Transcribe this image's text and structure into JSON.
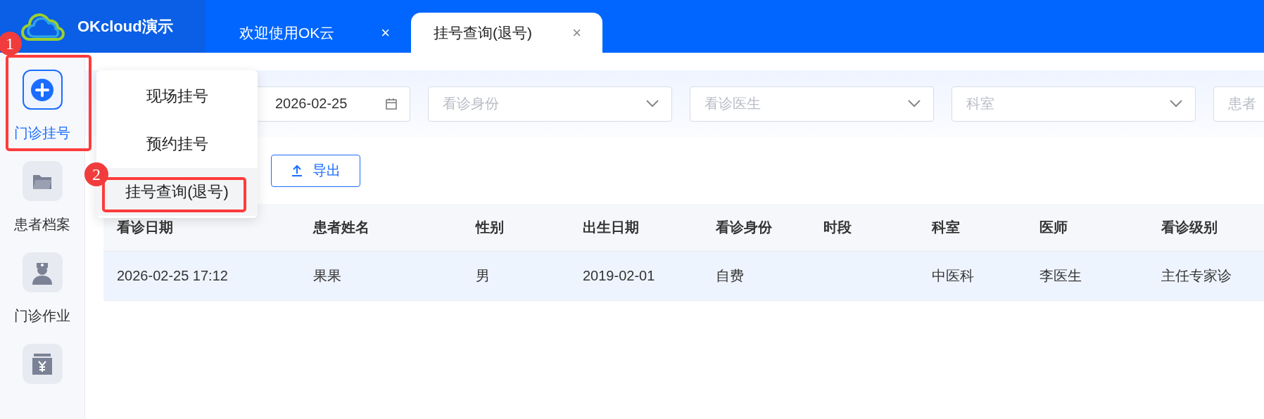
{
  "app": {
    "name": "OKcloud演示"
  },
  "tabs": [
    {
      "label": "欢迎使用OK云",
      "selected": false,
      "close": "×"
    },
    {
      "label": "挂号查询(退号)",
      "selected": true,
      "close": "×"
    }
  ],
  "sidebar": {
    "items": [
      {
        "label": "门诊挂号",
        "selected": true
      },
      {
        "label": "患者档案",
        "selected": false
      },
      {
        "label": "门诊作业",
        "selected": false
      },
      {
        "selected": false
      }
    ]
  },
  "menu": {
    "items": [
      {
        "label": "现场挂号",
        "selected": false
      },
      {
        "label": "预约挂号",
        "selected": false
      },
      {
        "label": "挂号查询(退号)",
        "selected": true
      }
    ]
  },
  "filters": [
    {
      "kind": "date",
      "value": "2026-02-25"
    },
    {
      "kind": "select",
      "placeholder": "看诊身份"
    },
    {
      "kind": "select",
      "placeholder": "看诊医生"
    },
    {
      "kind": "select",
      "placeholder": "科室"
    },
    {
      "kind": "input",
      "placeholder": "患者"
    }
  ],
  "toolbar": {
    "export_button": "导出"
  },
  "table": {
    "columns": [
      "看诊日期",
      "患者姓名",
      "性别",
      "出生日期",
      "看诊身份",
      "时段",
      "科室",
      "医师",
      "看诊级别"
    ],
    "rows": [
      {
        "selected": true,
        "cells": [
          "2026-02-25 17:12",
          "果果",
          "男",
          "2019-02-01",
          "自费",
          "",
          "中医科",
          "李医生",
          "主任专家诊"
        ]
      }
    ]
  },
  "annotations": [
    {
      "label": "1"
    },
    {
      "label": "2"
    }
  ]
}
